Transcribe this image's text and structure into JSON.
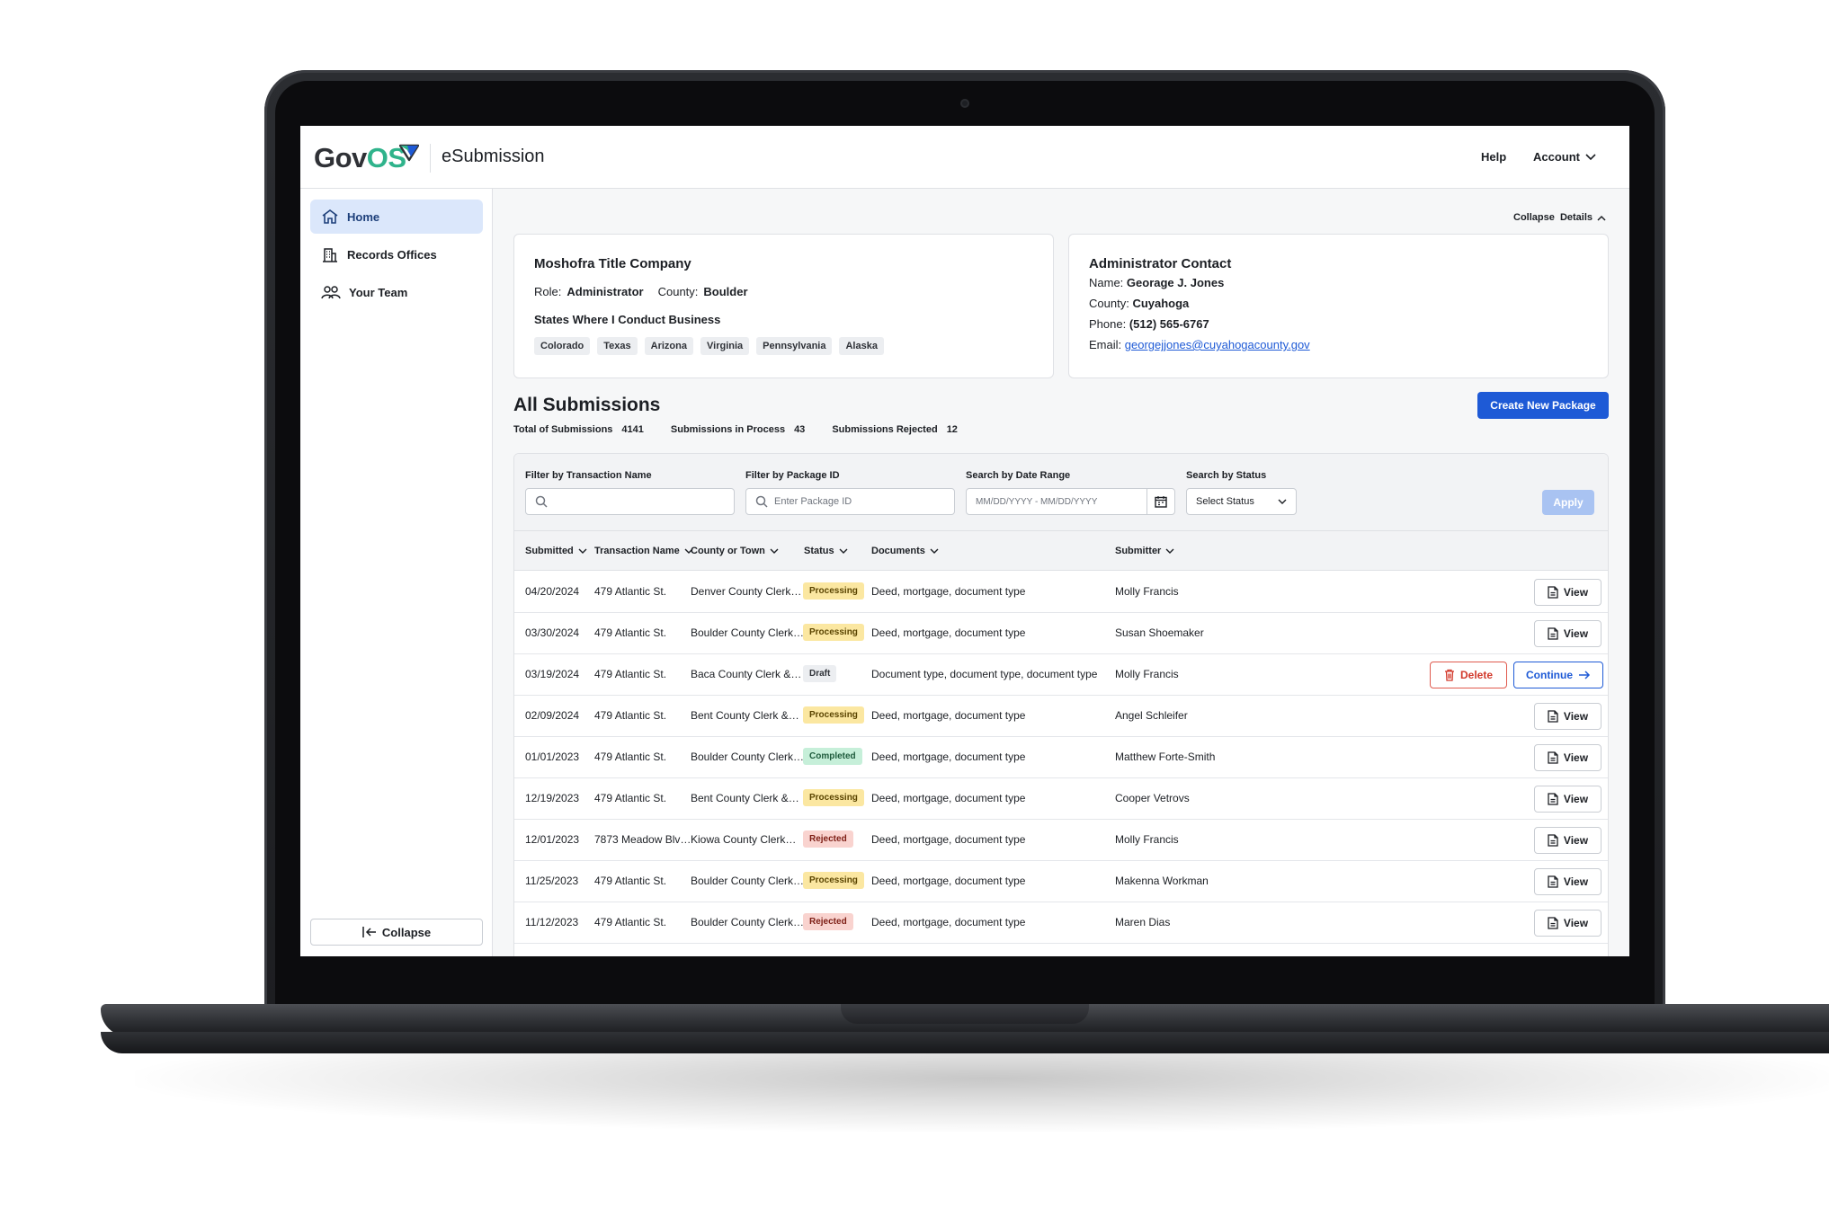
{
  "header": {
    "logo_prefix": "Gov",
    "logo_suffix": "OS",
    "app_name": "eSubmission",
    "help": "Help",
    "account": "Account"
  },
  "sidebar": {
    "items": [
      {
        "label": "Home",
        "icon": "home-icon"
      },
      {
        "label": "Records Offices",
        "icon": "building-icon"
      },
      {
        "label": "Your Team",
        "icon": "team-icon"
      }
    ],
    "collapse": "Collapse"
  },
  "details": {
    "collapse": "Collapse  Details",
    "company": {
      "name": "Moshofra Title Company",
      "role_label": "Role:",
      "role": "Administrator",
      "county_label": "County:",
      "county": "Boulder",
      "states_title": "States Where I Conduct Business",
      "states": [
        "Colorado",
        "Texas",
        "Arizona",
        "Virginia",
        "Pennsylvania",
        "Alaska"
      ]
    },
    "admin": {
      "title": "Administrator Contact",
      "name_label": "Name:",
      "name": "Georage J. Jones",
      "county_label": "County:",
      "county": "Cuyahoga",
      "phone_label": "Phone:",
      "phone": "(512) 565-6767",
      "email_label": "Email:",
      "email": "georgejjones@cuyahogacounty.gov"
    }
  },
  "submissions": {
    "title": "All Submissions",
    "total_label": "Total of Submissions",
    "total": "4141",
    "process_label": "Submissions in Process",
    "process": "43",
    "rejected_label": "Submissions Rejected",
    "rejected": "12",
    "create_button": "Create New Package"
  },
  "filters": {
    "transaction_label": "Filter by Transaction Name",
    "transaction_placeholder": "",
    "package_label": "Filter by Package ID",
    "package_placeholder": "Enter Package ID",
    "date_label": "Search by Date Range",
    "date_placeholder": "MM/DD/YYYY - MM/DD/YYYY",
    "status_label": "Search by Status",
    "status_value": "Select Status",
    "apply": "Apply"
  },
  "table": {
    "columns": [
      "Submitted",
      "Transaction Name",
      "County or Town",
      "Status",
      "Documents",
      "Submitter"
    ],
    "view_label": "View",
    "delete_label": "Delete",
    "continue_label": "Continue",
    "rows": [
      {
        "submitted": "04/20/2024",
        "transaction": "479 Atlantic St.",
        "county": "Denver County Clerk…",
        "status": "Processing",
        "documents": "Deed, mortgage, document type",
        "submitter": "Molly Francis"
      },
      {
        "submitted": "03/30/2024",
        "transaction": "479 Atlantic St.",
        "county": "Boulder County Clerk…",
        "status": "Processing",
        "documents": "Deed, mortgage, document type",
        "submitter": "Susan Shoemaker"
      },
      {
        "submitted": "03/19/2024",
        "transaction": "479 Atlantic St.",
        "county": "Baca County Clerk &…",
        "status": "Draft",
        "documents": "Document type, document type, document type",
        "submitter": "Molly Francis"
      },
      {
        "submitted": "02/09/2024",
        "transaction": "479 Atlantic St.",
        "county": "Bent County Clerk &…",
        "status": "Processing",
        "documents": "Deed, mortgage, document type",
        "submitter": "Angel Schleifer"
      },
      {
        "submitted": "01/01/2023",
        "transaction": "479 Atlantic St.",
        "county": "Boulder County Clerk…",
        "status": "Completed",
        "documents": "Deed, mortgage, document type",
        "submitter": "Matthew Forte-Smith"
      },
      {
        "submitted": "12/19/2023",
        "transaction": "479 Atlantic St.",
        "county": "Bent County Clerk &…",
        "status": "Processing",
        "documents": "Deed, mortgage, document type",
        "submitter": "Cooper Vetrovs"
      },
      {
        "submitted": "12/01/2023",
        "transaction": "7873 Meadow Blv…",
        "county": "Kiowa County Clerk…",
        "status": "Rejected",
        "documents": "Deed, mortgage, document type",
        "submitter": "Molly Francis"
      },
      {
        "submitted": "11/25/2023",
        "transaction": "479 Atlantic St.",
        "county": "Boulder County Clerk…",
        "status": "Processing",
        "documents": "Deed, mortgage, document type",
        "submitter": "Makenna Workman"
      },
      {
        "submitted": "11/12/2023",
        "transaction": "479 Atlantic St.",
        "county": "Boulder County Clerk…",
        "status": "Rejected",
        "documents": "Deed, mortgage, document type",
        "submitter": "Maren Dias"
      }
    ]
  },
  "colors": {
    "brand_green": "#2fb38b",
    "primary_blue": "#1e5ad6",
    "danger_red": "#d2392b",
    "processing": "#fbe7a1",
    "completed": "#c6efd9",
    "rejected": "#f9d3cf"
  }
}
